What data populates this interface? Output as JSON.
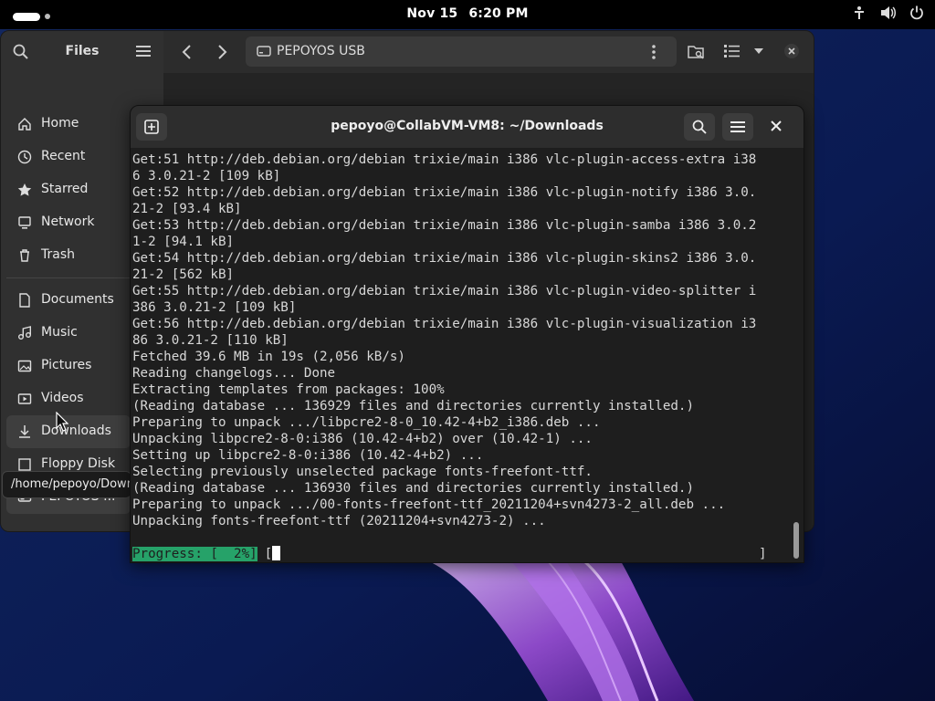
{
  "topbar": {
    "date": "Nov 15",
    "time": "6:20 PM",
    "tray_icons": [
      "accessibility-icon",
      "volume-icon",
      "power-icon"
    ]
  },
  "files": {
    "title": "Files",
    "path_label": "PEPOYOS USB",
    "sidebar_items": [
      {
        "label": "Home",
        "icon": "home-icon"
      },
      {
        "label": "Recent",
        "icon": "clock-icon"
      },
      {
        "label": "Starred",
        "icon": "star-icon"
      },
      {
        "label": "Network",
        "icon": "network-icon"
      },
      {
        "label": "Trash",
        "icon": "trash-icon"
      },
      {
        "label": "Documents",
        "icon": "document-icon"
      },
      {
        "label": "Music",
        "icon": "music-icon"
      },
      {
        "label": "Pictures",
        "icon": "picture-icon"
      },
      {
        "label": "Videos",
        "icon": "video-icon"
      },
      {
        "label": "Downloads",
        "icon": "download-icon"
      },
      {
        "label": "Floppy Disk",
        "icon": "floppy-icon"
      },
      {
        "label": "PEPOYOS ...",
        "icon": "drive-icon"
      }
    ],
    "tooltip": "/home/pepoyo/Downloads"
  },
  "terminal": {
    "title": "pepoyo@CollabVM-VM8: ~/Downloads",
    "lines": [
      "Get:51 http://deb.debian.org/debian trixie/main i386 vlc-plugin-access-extra i38",
      "6 3.0.21-2 [109 kB]",
      "Get:52 http://deb.debian.org/debian trixie/main i386 vlc-plugin-notify i386 3.0.",
      "21-2 [93.4 kB]",
      "Get:53 http://deb.debian.org/debian trixie/main i386 vlc-plugin-samba i386 3.0.2",
      "1-2 [94.1 kB]",
      "Get:54 http://deb.debian.org/debian trixie/main i386 vlc-plugin-skins2 i386 3.0.",
      "21-2 [562 kB]",
      "Get:55 http://deb.debian.org/debian trixie/main i386 vlc-plugin-video-splitter i",
      "386 3.0.21-2 [109 kB]",
      "Get:56 http://deb.debian.org/debian trixie/main i386 vlc-plugin-visualization i3",
      "86 3.0.21-2 [110 kB]",
      "Fetched 39.6 MB in 19s (2,056 kB/s)",
      "Reading changelogs... Done",
      "Extracting templates from packages: 100%",
      "(Reading database ... 136929 files and directories currently installed.)",
      "Preparing to unpack .../libpcre2-8-0_10.42-4+b2_i386.deb ...",
      "Unpacking libpcre2-8-0:i386 (10.42-4+b2) over (10.42-1) ...",
      "Setting up libpcre2-8-0:i386 (10.42-4+b2) ...",
      "Selecting previously unselected package fonts-freefont-ttf.",
      "(Reading database ... 136930 files and directories currently installed.)",
      "Preparing to unpack .../00-fonts-freefont-ttf_20211204+svn4273-2_all.deb ...",
      "Unpacking fonts-freefont-ttf (20211204+svn4273-2) ..."
    ],
    "progress_label": "Progress: [  2%]",
    "progress_open": "[",
    "progress_close": "]",
    "progress_value": 0.02,
    "accent": "#26a269"
  }
}
